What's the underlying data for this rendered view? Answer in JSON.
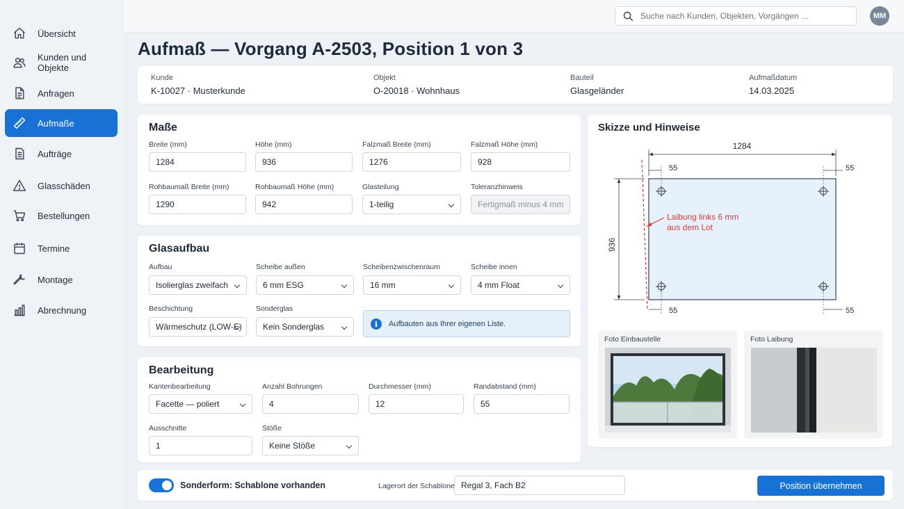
{
  "nav": {
    "items": [
      {
        "label": "Übersicht",
        "icon": "home-icon"
      },
      {
        "label": "Kunden und Objekte",
        "icon": "users-icon"
      },
      {
        "label": "Anfragen",
        "icon": "document-icon"
      },
      {
        "label": "Aufmaße",
        "icon": "ruler-icon",
        "active": true
      },
      {
        "label": "Aufträge",
        "icon": "clipboard-icon"
      },
      {
        "label": "Glasschäden",
        "icon": "warning-icon"
      },
      {
        "label": "Bestellungen",
        "icon": "cart-icon"
      },
      {
        "label": "Termine",
        "icon": "calendar-icon"
      },
      {
        "label": "Montage",
        "icon": "wrench-icon"
      },
      {
        "label": "Abrechnung",
        "icon": "bar-chart-icon"
      }
    ]
  },
  "topbar": {
    "search_placeholder": "Suche nach Kunden, Objekten, Vorgängen ...",
    "avatar_initials": "MM"
  },
  "page": {
    "title": "Aufmaß — Vorgang A-2503, Position 1 von 3"
  },
  "info": {
    "kunde_label": "Kunde",
    "kunde_value": "K-10027 · Musterkunde",
    "objekt_label": "Objekt",
    "objekt_value": "O-20018 · Wohnhaus",
    "bauteil_label": "Bauteil",
    "bauteil_value": "Glasgeländer",
    "datum_label": "Aufmaßdatum",
    "datum_value": "14.03.2025"
  },
  "masse": {
    "title": "Maße",
    "breite_label": "Breite (mm)",
    "breite": "1284",
    "hoehe_label": "Höhe (mm)",
    "hoehe": "936",
    "falz_breite_label": "Falzmaß Breite (mm)",
    "falz_breite": "1276",
    "falz_hoehe_label": "Falzmaß Höhe (mm)",
    "falz_hoehe": "928",
    "roh_breite_label": "Rohbaumaß Breite (mm)",
    "roh_breite": "1290",
    "roh_hoehe_label": "Rohbaumaß Höhe (mm)",
    "roh_hoehe": "942",
    "glasteilung_label": "Glasteilung",
    "glasteilung": "1-teilig",
    "toleranz_label": "Toleranzhinweis",
    "toleranz_placeholder": "Fertigmaß minus 4 mm"
  },
  "glasaufbau": {
    "title": "Glasaufbau",
    "aufbau_label": "Aufbau",
    "aufbau": "Isolierglas zweifach",
    "aussen_label": "Scheibe außen",
    "aussen": "6 mm ESG",
    "szr_label": "Scheibenzwischenraum",
    "szr": "16 mm",
    "innen_label": "Scheibe innen",
    "innen": "4 mm Float",
    "beschichtung_label": "Beschichtung",
    "beschichtung": "Wärmeschutz (LOW-E)",
    "sonderglas_label": "Sonderglas",
    "sonderglas": "Kein Sonderglas",
    "note": "Aufbauten aus Ihrer eigenen Liste."
  },
  "bearbeitung": {
    "title": "Bearbeitung",
    "kanten_label": "Kantenbearbeitung",
    "kanten": "Facette — poliert",
    "bohrungen_label": "Anzahl Bohrungen",
    "bohrungen": "4",
    "durchmesser_label": "Durchmesser (mm)",
    "durchmesser": "12",
    "randabstand_label": "Randabstand (mm)",
    "randabstand": "55",
    "ausschnitte_label": "Ausschnitte",
    "ausschnitte": "1",
    "stoesse_label": "Stöße",
    "stoesse": "Keine Stöße"
  },
  "skizze": {
    "title": "Skizze und Hinweise",
    "width_dim": "1284",
    "height_dim": "936",
    "edge_dim": "55",
    "annotation_line1": "Laibung links 6 mm",
    "annotation_line2": "aus dem Lot",
    "accent_color": "#d93a3a",
    "photo1_label": "Foto Einbaustelle",
    "photo2_label": "Foto Laibung"
  },
  "footer": {
    "toggle_label": "Sonderform: Schablone vorhanden",
    "toggle_on": true,
    "lagerort_label": "Lagerort der Schablone",
    "lagerort": "Regal 3, Fach B2",
    "submit": "Position übernehmen"
  },
  "colors": {
    "primary": "#1872d6",
    "background": "#eef1f5"
  }
}
